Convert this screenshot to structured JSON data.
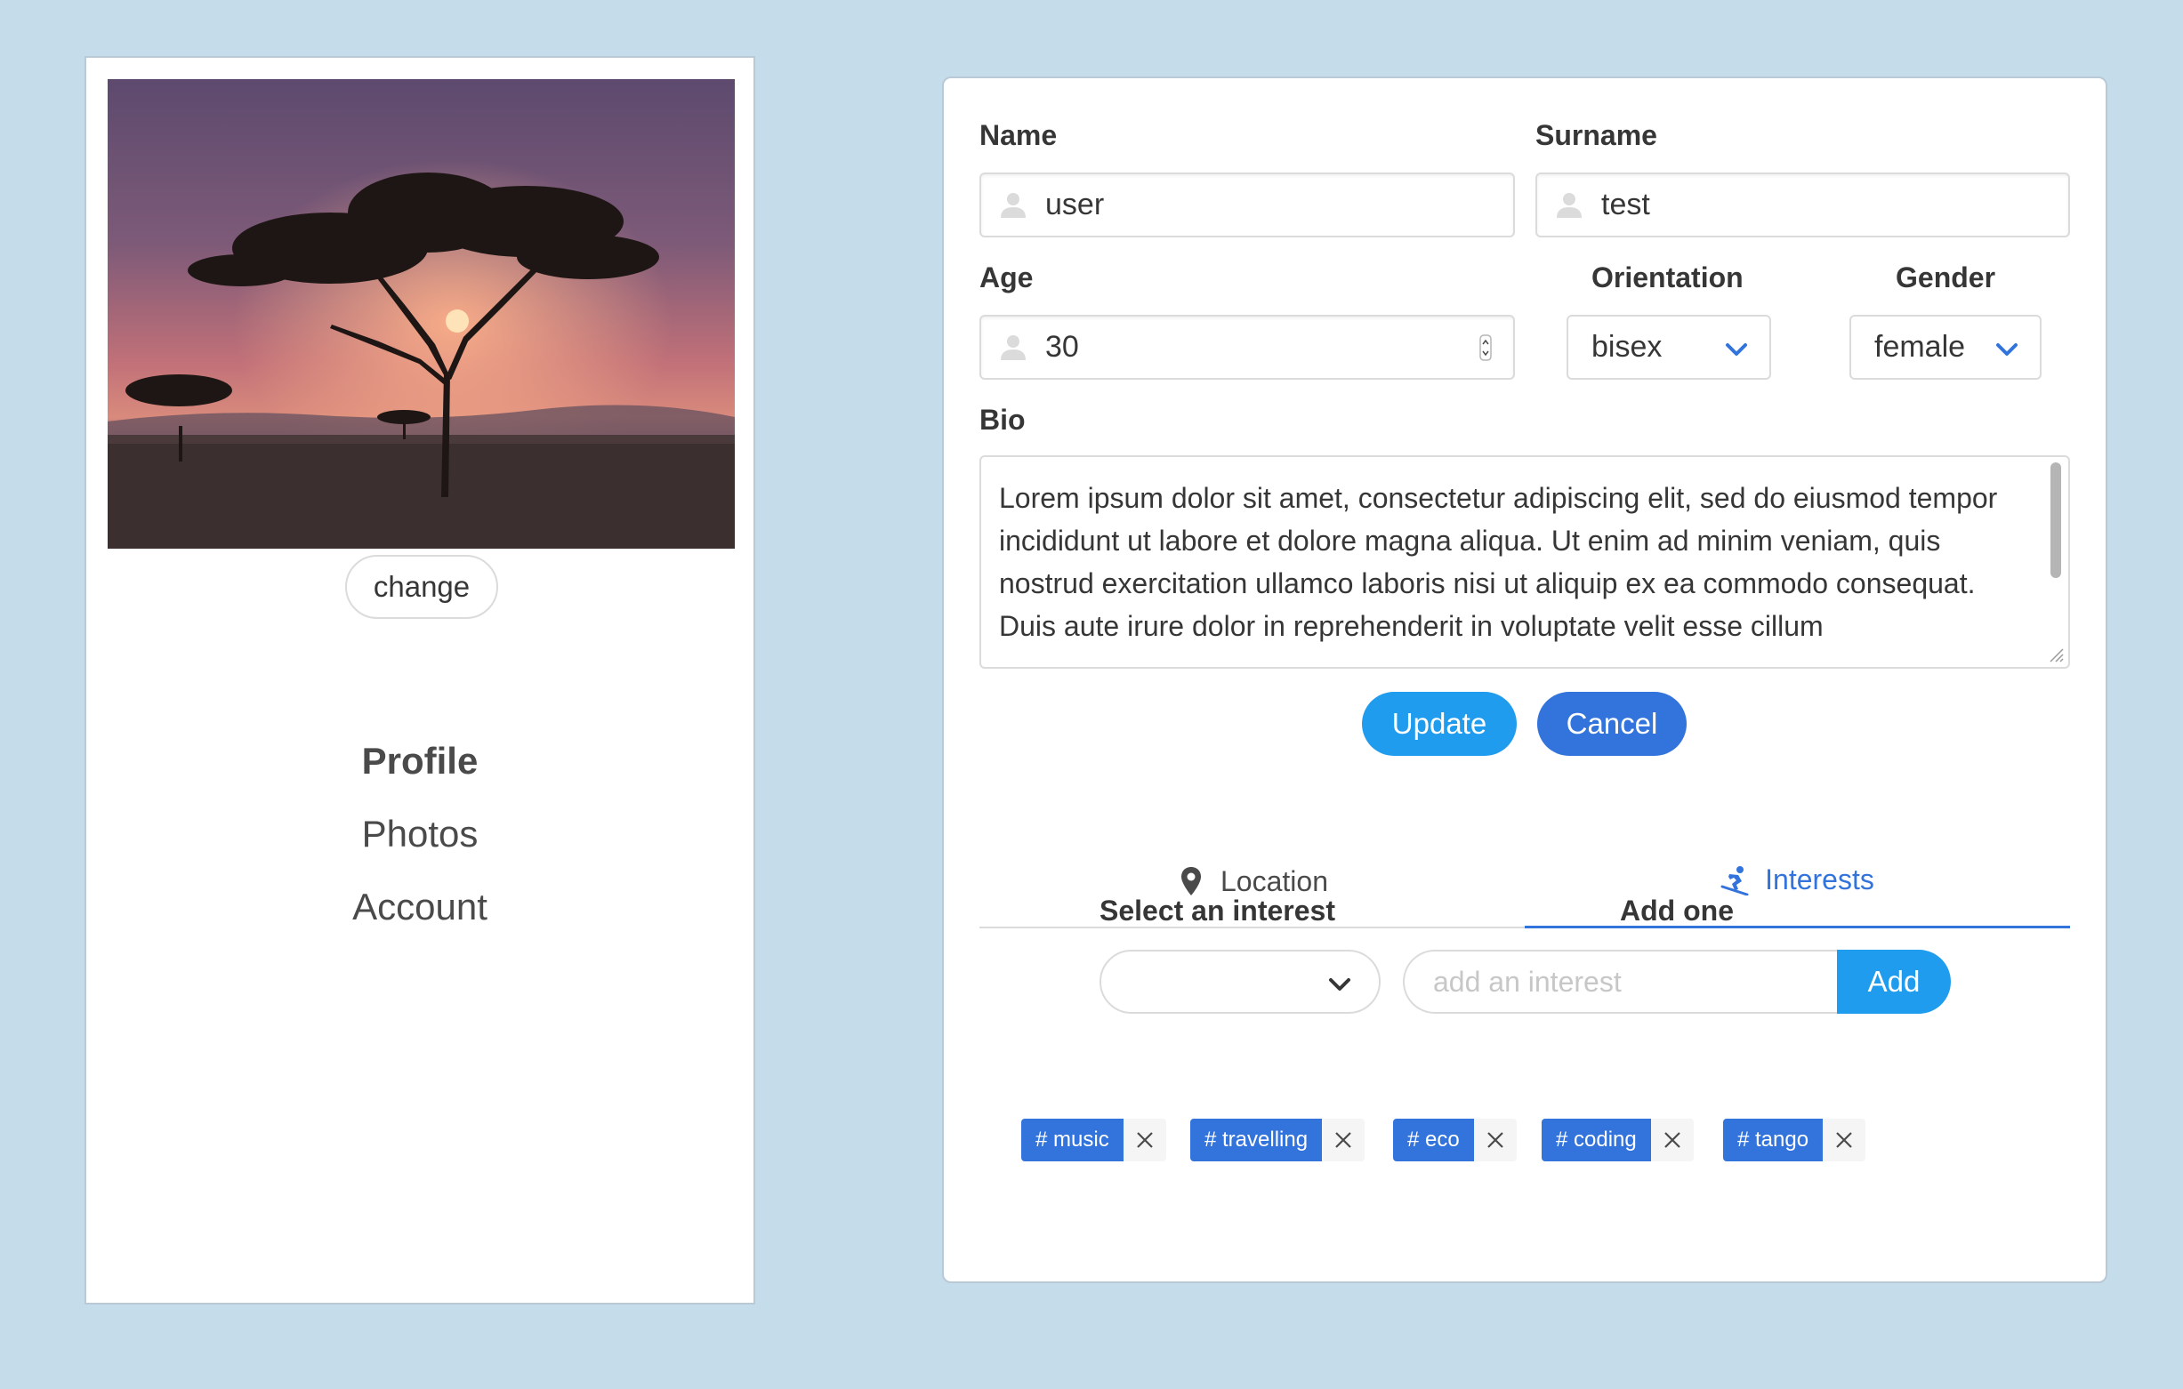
{
  "sidebar": {
    "change_label": "change",
    "nav": [
      {
        "label": "Profile",
        "active": true
      },
      {
        "label": "Photos",
        "active": false
      },
      {
        "label": "Account",
        "active": false
      }
    ]
  },
  "form": {
    "name": {
      "label": "Name",
      "value": "user",
      "icon": "user-icon"
    },
    "surname": {
      "label": "Surname",
      "value": "test",
      "icon": "user-icon"
    },
    "age": {
      "label": "Age",
      "value": "30",
      "icon": "user-icon"
    },
    "orientation": {
      "label": "Orientation",
      "value": "bisex"
    },
    "gender": {
      "label": "Gender",
      "value": "female"
    },
    "bio": {
      "label": "Bio",
      "value": "Lorem ipsum dolor sit amet, consectetur adipiscing elit, sed do eiusmod tempor incididunt ut labore et dolore magna aliqua. Ut enim ad minim veniam, quis nostrud exercitation ullamco laboris nisi ut aliquip ex ea commodo consequat. Duis aute irure dolor in reprehenderit in voluptate velit esse cillum"
    },
    "update_label": "Update",
    "cancel_label": "Cancel"
  },
  "tabs": [
    {
      "label": "Location",
      "icon": "map-marker-icon",
      "active": false
    },
    {
      "label": "Interests",
      "icon": "snowboarding-icon",
      "active": true
    }
  ],
  "interests": {
    "select_label": "Select an interest",
    "add_label": "Add one",
    "input_placeholder": "add an interest",
    "add_button": "Add",
    "tags": [
      "# music",
      "# travelling",
      "# eco",
      "# coding",
      "# tango"
    ]
  },
  "colors": {
    "background": "#c5dcea",
    "info": "#209cee",
    "link": "#3273dc"
  }
}
